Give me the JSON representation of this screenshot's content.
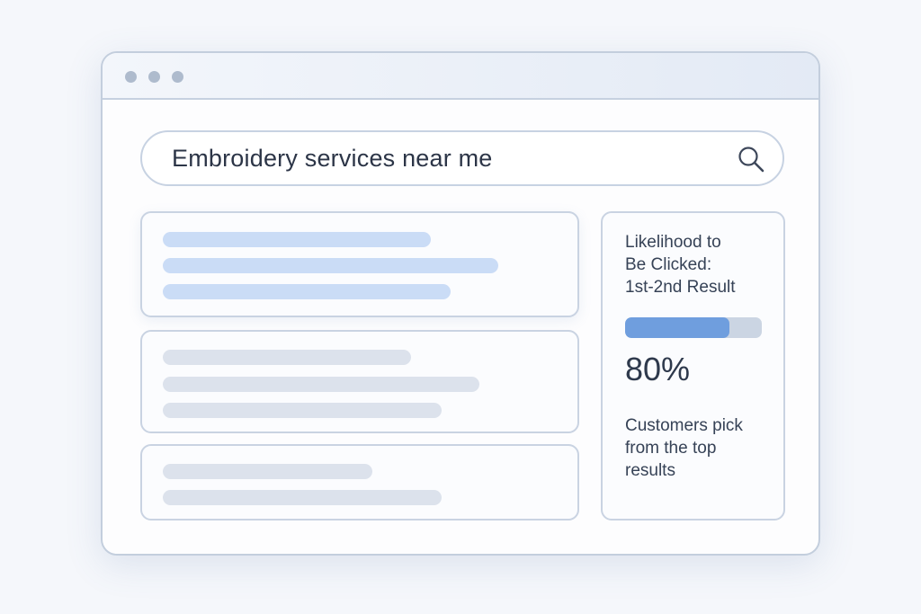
{
  "window": {
    "controls": [
      "window-dot",
      "window-dot",
      "window-dot"
    ]
  },
  "search": {
    "query": "Embroidery services near me",
    "icon": "search-icon"
  },
  "results": [
    {
      "style": "highlighted",
      "lines": 3
    },
    {
      "style": "plain",
      "lines": 3
    },
    {
      "style": "plain",
      "lines": 2
    }
  ],
  "sidebar": {
    "title": "Likelihood to\nBe Clicked:\n1st-2nd Result",
    "progress_percent": 76,
    "value": "80%",
    "note": "Customers pick\nfrom the top\nresults"
  },
  "colors": {
    "accent": "#6f9ede",
    "track": "#cbd5e3",
    "highlight_bar": "#cadcf6",
    "plain_bar": "#dce2ec",
    "border": "#c7d2e2"
  }
}
